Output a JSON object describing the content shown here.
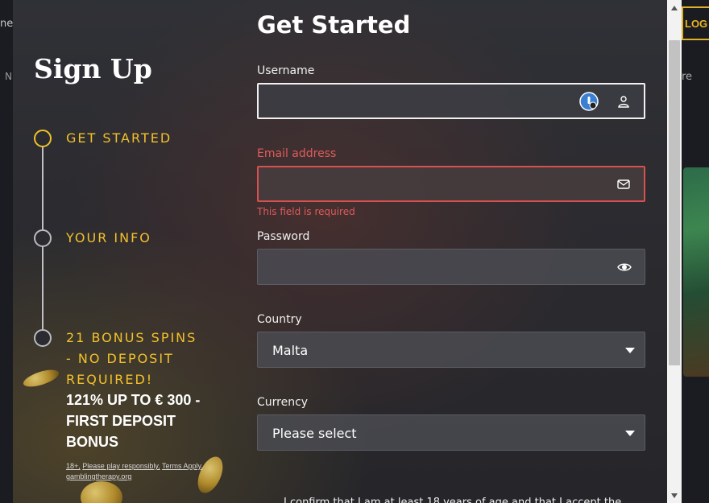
{
  "background": {
    "left_fragment_top": "ne",
    "left_fragment_mid": "N",
    "right_login_label": "LOG",
    "right_fragment": "re"
  },
  "signup": {
    "title": "Sign Up",
    "steps": [
      {
        "label": "GET STARTED",
        "state": "active"
      },
      {
        "label": "YOUR INFO",
        "state": "pending"
      },
      {
        "label_lines": [
          "21 BONUS SPINS",
          "- NO DEPOSIT",
          "REQUIRED!"
        ],
        "state": "pending"
      }
    ],
    "bonus_lines": [
      "121% UP TO € 300 -",
      "FIRST DEPOSIT",
      "BONUS"
    ],
    "fine_print": {
      "age": "18+,",
      "play_responsibly": "Please play responsibly,",
      "terms": "Terms Apply,",
      "gambling_therapy": "gamblingtherapy.org"
    }
  },
  "form": {
    "title": "Get Started",
    "username": {
      "label": "Username",
      "value": "",
      "placeholder": ""
    },
    "email": {
      "label": "Email address",
      "value": "",
      "placeholder": "",
      "error": "This field is required"
    },
    "password": {
      "label": "Password",
      "value": "",
      "placeholder": ""
    },
    "country": {
      "label": "Country",
      "selected": "Malta"
    },
    "currency": {
      "label": "Currency",
      "selected": "Please select"
    },
    "confirm_text": "I confirm that I am at least 18 years of age and that I accept the"
  },
  "icons": {
    "username_extension": "password-manager-icon",
    "username": "user-icon",
    "email": "envelope-icon",
    "password": "eye-icon",
    "dropdown": "caret-down-icon"
  },
  "colors": {
    "accent": "#f0c22b",
    "error": "#e05b5b",
    "modal_bg": "#2b2b30"
  }
}
